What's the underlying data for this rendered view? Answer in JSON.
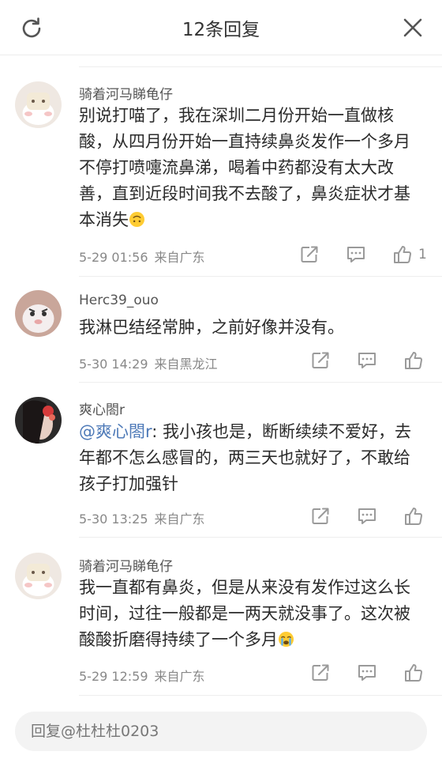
{
  "header": {
    "title": "12条回复"
  },
  "comments": [
    {
      "username": "骑着河马睇龟仔",
      "text": "别说打喵了，我在深圳二月份开始一直做核酸，从四月份开始一直持续鼻炎发作一个多月不停打喷嚏流鼻涕，喝着中药都没有太大改善，直到近段时间我不去酸了，鼻炎症状才基本消失",
      "emoji": "upside-down-face",
      "time": "5-29 01:56",
      "location": "来自广东",
      "likes": "1"
    },
    {
      "username": "Herc39_ouo",
      "text": "我淋巴结经常肿，之前好像并没有。",
      "time": "5-30 14:29",
      "location": "来自黑龙江"
    },
    {
      "username": "爽心閤r",
      "mention": "@爽心閤r",
      "text": ": 我小孩也是，断断续续不爱好，去年都不怎么感冒的，两三天也就好了，不敢给孩子打加强针",
      "time": "5-30 13:25",
      "location": "来自广东"
    },
    {
      "username": "骑着河马睇龟仔",
      "text": "我一直都有鼻炎，但是从来没有发作过这么长时间，过往一般都是一两天就没事了。这次被酸酸折磨得持续了一个多月",
      "emoji": "crying-face",
      "time": "5-29 12:59",
      "location": "来自广东"
    }
  ],
  "footer": {
    "reply_placeholder": "回复@杜杜杜0203"
  },
  "colors": {
    "mention": "#4e7ab8",
    "meta": "#888888",
    "icon": "#9a9a9a"
  }
}
